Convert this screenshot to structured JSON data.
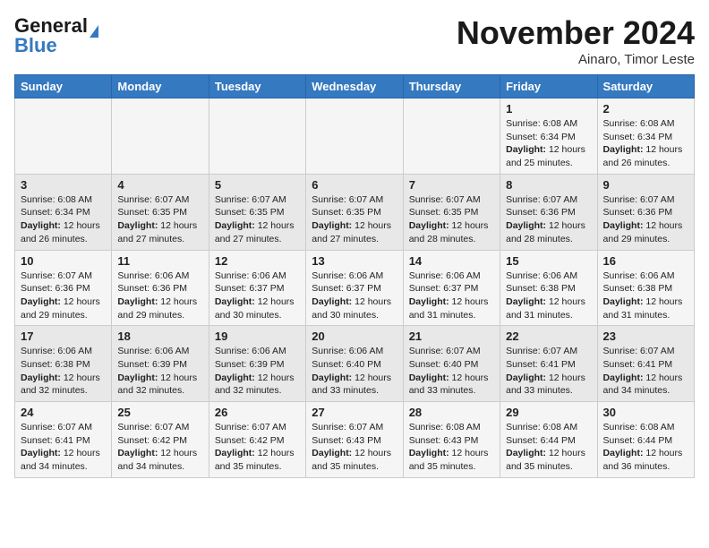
{
  "header": {
    "logo_line1": "General",
    "logo_line2": "Blue",
    "month": "November 2024",
    "location": "Ainaro, Timor Leste"
  },
  "days_of_week": [
    "Sunday",
    "Monday",
    "Tuesday",
    "Wednesday",
    "Thursday",
    "Friday",
    "Saturday"
  ],
  "weeks": [
    [
      {
        "day": "",
        "info": ""
      },
      {
        "day": "",
        "info": ""
      },
      {
        "day": "",
        "info": ""
      },
      {
        "day": "",
        "info": ""
      },
      {
        "day": "",
        "info": ""
      },
      {
        "day": "1",
        "info": "Sunrise: 6:08 AM\nSunset: 6:34 PM\nDaylight: 12 hours and 25 minutes."
      },
      {
        "day": "2",
        "info": "Sunrise: 6:08 AM\nSunset: 6:34 PM\nDaylight: 12 hours and 26 minutes."
      }
    ],
    [
      {
        "day": "3",
        "info": "Sunrise: 6:08 AM\nSunset: 6:34 PM\nDaylight: 12 hours and 26 minutes."
      },
      {
        "day": "4",
        "info": "Sunrise: 6:07 AM\nSunset: 6:35 PM\nDaylight: 12 hours and 27 minutes."
      },
      {
        "day": "5",
        "info": "Sunrise: 6:07 AM\nSunset: 6:35 PM\nDaylight: 12 hours and 27 minutes."
      },
      {
        "day": "6",
        "info": "Sunrise: 6:07 AM\nSunset: 6:35 PM\nDaylight: 12 hours and 27 minutes."
      },
      {
        "day": "7",
        "info": "Sunrise: 6:07 AM\nSunset: 6:35 PM\nDaylight: 12 hours and 28 minutes."
      },
      {
        "day": "8",
        "info": "Sunrise: 6:07 AM\nSunset: 6:36 PM\nDaylight: 12 hours and 28 minutes."
      },
      {
        "day": "9",
        "info": "Sunrise: 6:07 AM\nSunset: 6:36 PM\nDaylight: 12 hours and 29 minutes."
      }
    ],
    [
      {
        "day": "10",
        "info": "Sunrise: 6:07 AM\nSunset: 6:36 PM\nDaylight: 12 hours and 29 minutes."
      },
      {
        "day": "11",
        "info": "Sunrise: 6:06 AM\nSunset: 6:36 PM\nDaylight: 12 hours and 29 minutes."
      },
      {
        "day": "12",
        "info": "Sunrise: 6:06 AM\nSunset: 6:37 PM\nDaylight: 12 hours and 30 minutes."
      },
      {
        "day": "13",
        "info": "Sunrise: 6:06 AM\nSunset: 6:37 PM\nDaylight: 12 hours and 30 minutes."
      },
      {
        "day": "14",
        "info": "Sunrise: 6:06 AM\nSunset: 6:37 PM\nDaylight: 12 hours and 31 minutes."
      },
      {
        "day": "15",
        "info": "Sunrise: 6:06 AM\nSunset: 6:38 PM\nDaylight: 12 hours and 31 minutes."
      },
      {
        "day": "16",
        "info": "Sunrise: 6:06 AM\nSunset: 6:38 PM\nDaylight: 12 hours and 31 minutes."
      }
    ],
    [
      {
        "day": "17",
        "info": "Sunrise: 6:06 AM\nSunset: 6:38 PM\nDaylight: 12 hours and 32 minutes."
      },
      {
        "day": "18",
        "info": "Sunrise: 6:06 AM\nSunset: 6:39 PM\nDaylight: 12 hours and 32 minutes."
      },
      {
        "day": "19",
        "info": "Sunrise: 6:06 AM\nSunset: 6:39 PM\nDaylight: 12 hours and 32 minutes."
      },
      {
        "day": "20",
        "info": "Sunrise: 6:06 AM\nSunset: 6:40 PM\nDaylight: 12 hours and 33 minutes."
      },
      {
        "day": "21",
        "info": "Sunrise: 6:07 AM\nSunset: 6:40 PM\nDaylight: 12 hours and 33 minutes."
      },
      {
        "day": "22",
        "info": "Sunrise: 6:07 AM\nSunset: 6:41 PM\nDaylight: 12 hours and 33 minutes."
      },
      {
        "day": "23",
        "info": "Sunrise: 6:07 AM\nSunset: 6:41 PM\nDaylight: 12 hours and 34 minutes."
      }
    ],
    [
      {
        "day": "24",
        "info": "Sunrise: 6:07 AM\nSunset: 6:41 PM\nDaylight: 12 hours and 34 minutes."
      },
      {
        "day": "25",
        "info": "Sunrise: 6:07 AM\nSunset: 6:42 PM\nDaylight: 12 hours and 34 minutes."
      },
      {
        "day": "26",
        "info": "Sunrise: 6:07 AM\nSunset: 6:42 PM\nDaylight: 12 hours and 35 minutes."
      },
      {
        "day": "27",
        "info": "Sunrise: 6:07 AM\nSunset: 6:43 PM\nDaylight: 12 hours and 35 minutes."
      },
      {
        "day": "28",
        "info": "Sunrise: 6:08 AM\nSunset: 6:43 PM\nDaylight: 12 hours and 35 minutes."
      },
      {
        "day": "29",
        "info": "Sunrise: 6:08 AM\nSunset: 6:44 PM\nDaylight: 12 hours and 35 minutes."
      },
      {
        "day": "30",
        "info": "Sunrise: 6:08 AM\nSunset: 6:44 PM\nDaylight: 12 hours and 36 minutes."
      }
    ]
  ]
}
